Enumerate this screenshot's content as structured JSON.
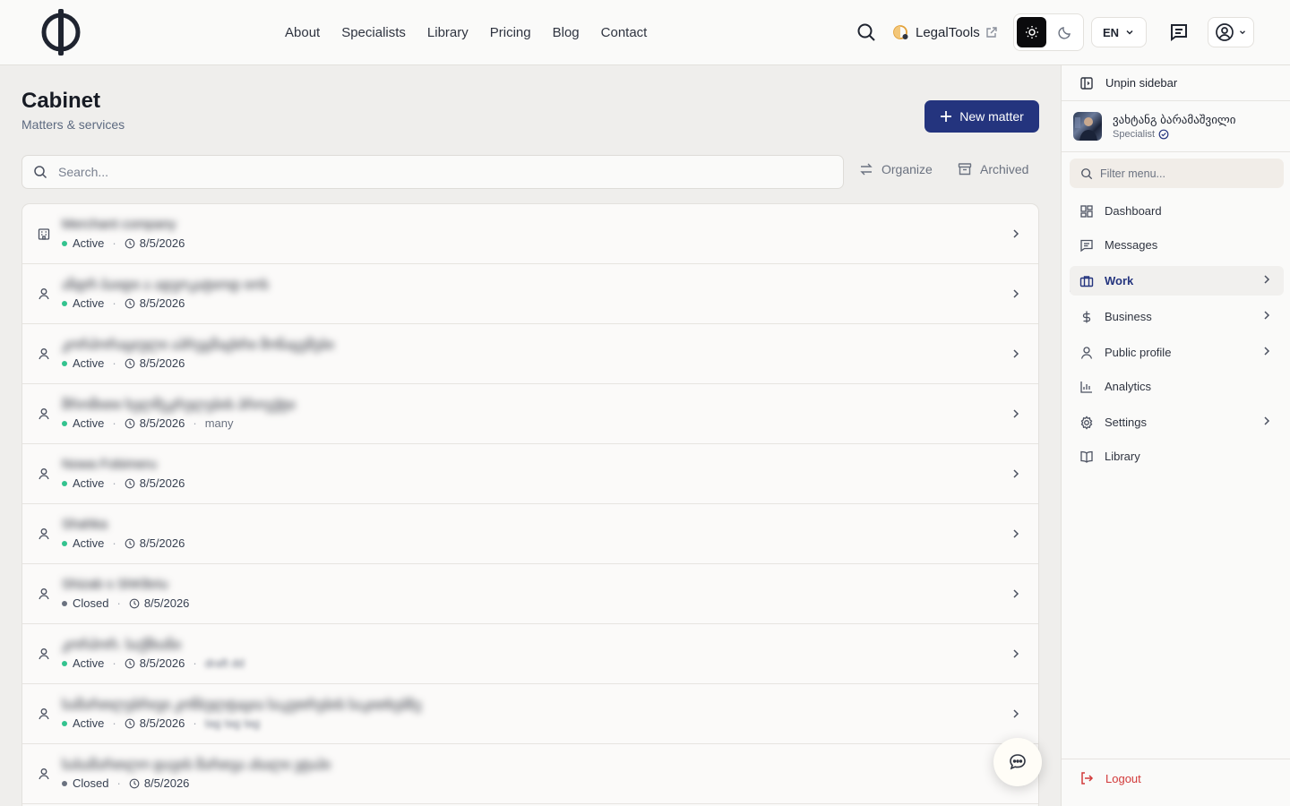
{
  "header": {
    "nav": [
      "About",
      "Specialists",
      "Library",
      "Pricing",
      "Blog",
      "Contact"
    ],
    "legaltools_label": "LegalTools",
    "language": "EN"
  },
  "main": {
    "title": "Cabinet",
    "subtitle": "Matters & services",
    "new_button": "New matter",
    "search_placeholder": "Search...",
    "organize_label": "Organize",
    "archived_label": "Archived",
    "rows": [
      {
        "icon": "building-icon",
        "name": "Merchant company",
        "status": "Active",
        "status_color": "#34c38f",
        "date": "8/5/2026",
        "extra": "",
        "extra_blur": false
      },
      {
        "icon": "person-icon",
        "name": "ანდრ ბაიდი ა ადვოკატიოდ იოს",
        "status": "Active",
        "status_color": "#34c38f",
        "date": "8/5/2026",
        "extra": "",
        "extra_blur": false
      },
      {
        "icon": "person-icon",
        "name": "კორპორაციული აპრეგმაცხრი მონაცემები",
        "status": "Active",
        "status_color": "#34c38f",
        "date": "8/5/2026",
        "extra": "",
        "extra_blur": false
      },
      {
        "icon": "person-icon",
        "name": "შრომითი ხელშეკრულების პროექტი",
        "status": "Active",
        "status_color": "#34c38f",
        "date": "8/5/2026",
        "extra": "many",
        "extra_blur": false
      },
      {
        "icon": "person-icon",
        "name": "Nowa Fobimeru",
        "status": "Active",
        "status_color": "#34c38f",
        "date": "8/5/2026",
        "extra": "",
        "extra_blur": false
      },
      {
        "icon": "person-icon",
        "name": "Shahka",
        "status": "Active",
        "status_color": "#34c38f",
        "date": "8/5/2026",
        "extra": "",
        "extra_blur": false
      },
      {
        "icon": "person-icon",
        "name": "Shizab s ShKlbriu",
        "status": "Closed",
        "status_color": "#6b7280",
        "date": "8/5/2026",
        "extra": "",
        "extra_blur": false
      },
      {
        "icon": "person-icon",
        "name": "კორპორ. საქმიანი",
        "status": "Active",
        "status_color": "#34c38f",
        "date": "8/5/2026",
        "extra": "draft dd",
        "extra_blur": true
      },
      {
        "icon": "person-icon",
        "name": "სამართლებრივი კონსულტაცია საკუთრების საკითხებზე",
        "status": "Active",
        "status_color": "#34c38f",
        "date": "8/5/2026",
        "extra": "tag tag tag",
        "extra_blur": true
      },
      {
        "icon": "person-icon",
        "name": "სასამართლო დავის მართვა ახალი ეტაპი",
        "status": "Closed",
        "status_color": "#6b7280",
        "date": "8/5/2026",
        "extra": "",
        "extra_blur": false
      }
    ]
  },
  "sidebar": {
    "unpin_label": "Unpin sidebar",
    "profile_name": "ვახტანგ ბარამაშვილი",
    "profile_role": "Specialist",
    "filter_placeholder": "Filter menu...",
    "menu": [
      {
        "label": "Dashboard",
        "icon": "dashboard-icon",
        "has_arrow": false,
        "active": false
      },
      {
        "label": "Messages",
        "icon": "message-icon",
        "has_arrow": false,
        "active": false
      },
      {
        "label": "Work",
        "icon": "briefcase-icon",
        "has_arrow": true,
        "active": true
      },
      {
        "label": "Business",
        "icon": "dollar-icon",
        "has_arrow": true,
        "active": false
      },
      {
        "label": "Public profile",
        "icon": "user-icon",
        "has_arrow": true,
        "active": false
      },
      {
        "label": "Analytics",
        "icon": "chart-icon",
        "has_arrow": false,
        "active": false
      },
      {
        "label": "Settings",
        "icon": "gear-icon",
        "has_arrow": true,
        "active": false
      },
      {
        "label": "Library",
        "icon": "book-icon",
        "has_arrow": false,
        "active": false
      }
    ],
    "logout_label": "Logout"
  },
  "colors": {
    "accent": "#24347e",
    "active_status": "#34c38f",
    "closed_status": "#6b7280",
    "logout": "#d23a3a"
  }
}
